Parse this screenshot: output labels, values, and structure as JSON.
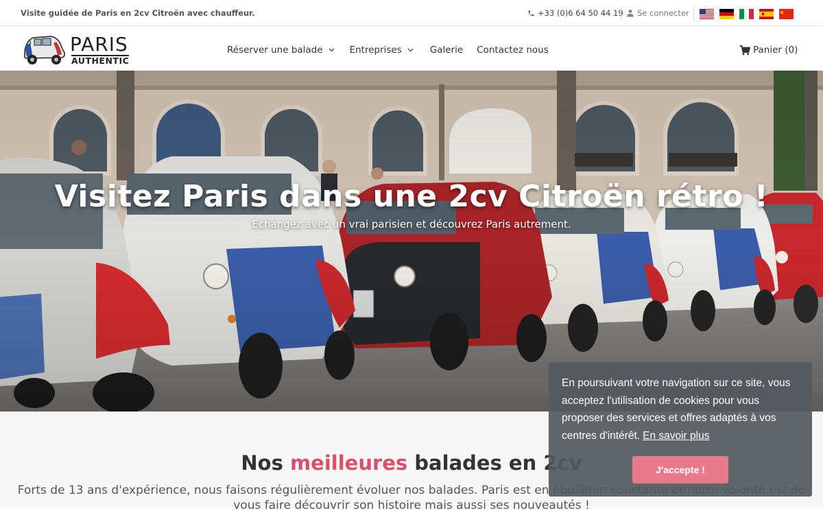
{
  "topbar": {
    "tagline": "Visite guidée de Paris en 2cv Citroën avec chauffeur.",
    "phone": "+33 (0)6 64 50 44 19",
    "login": "Se connecter",
    "flags": [
      "en",
      "de",
      "it",
      "es",
      "zh"
    ]
  },
  "header": {
    "logo_line1": "PARIS",
    "logo_line2": "AUTHENTIC",
    "nav": [
      "Réserver une balade",
      "Entreprises",
      "Galerie",
      "Contactez nous"
    ],
    "cart": "Panier (0)"
  },
  "hero": {
    "title": "Visitez Paris dans une 2cv Citroën rétro !",
    "subtitle": "Echangez avec un vrai parisien et découvrez Paris autrement."
  },
  "section": {
    "title_pre": "Nos ",
    "title_accent": "meilleures",
    "title_post": " balades en 2cv",
    "text": "Forts de 13 ans d'expérience, nous faisons régulièrement évoluer nos balades. Paris est en ébullition constante et notre volonté est de vous faire découvrir son histoire mais aussi ses nouveautés !"
  },
  "cookie": {
    "message": "En poursuivant votre navigation sur ce site, vous acceptez l'utilisation de cookies pour vous proposer des services et offres adaptés à vos centres d'intérêt.",
    "link": "En savoir plus",
    "accept": "J'accepte !"
  },
  "colors": {
    "accent": "#d9506d",
    "cookie_button": "#e97a8b",
    "cookie_bg": "#545960"
  }
}
